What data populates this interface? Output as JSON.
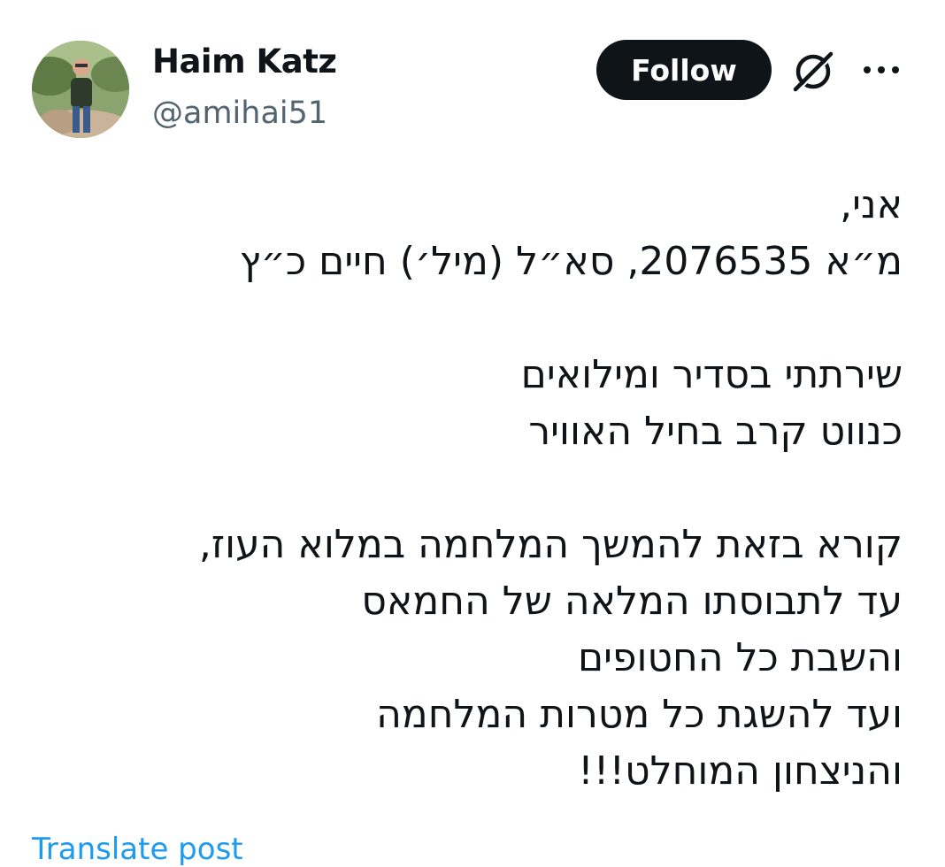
{
  "author": {
    "display_name": "Haim Katz",
    "handle": "@amihai51",
    "avatar_icon": "profile-photo"
  },
  "actions": {
    "follow_label": "Follow",
    "grok_icon": "grok-icon",
    "more_icon": "more-icon"
  },
  "tweet": {
    "lines": [
      "אני,",
      "מ״א 2076535, סא״ל (מיל׳) חיים כ״ץ",
      "",
      "שירתתי בסדיר ומילואים",
      "כנווט קרב בחיל האוויר",
      "",
      "קורא בזאת להמשך המלחמה במלוא העוז,",
      "עד לתבוסתו המלאה של החמאס",
      "והשבת כל החטופים",
      "ועד להשגת כל מטרות המלחמה",
      "והניצחון המוחלט!!!"
    ],
    "translate_label": "Translate post"
  },
  "colors": {
    "text": "#0f1419",
    "secondary": "#536471",
    "link": "#1d9bf0",
    "button_bg": "#0f1419"
  }
}
